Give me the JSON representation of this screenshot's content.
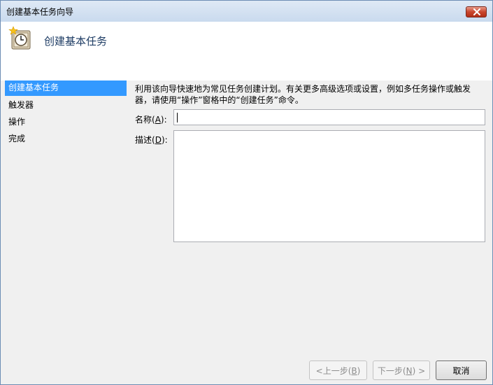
{
  "window": {
    "title": "创建基本任务向导"
  },
  "header": {
    "title": "创建基本任务"
  },
  "nav": {
    "items": [
      {
        "label": "创建基本任务",
        "active": true
      },
      {
        "label": "触发器",
        "active": false
      },
      {
        "label": "操作",
        "active": false
      },
      {
        "label": "完成",
        "active": false
      }
    ]
  },
  "main": {
    "description": "利用该向导快速地为常见任务创建计划。有关更多高级选项或设置，例如多任务操作或触发器，请使用“操作”窗格中的“创建任务”命令。",
    "name_label": "名称",
    "name_key": "A",
    "name_value": "",
    "desc_label": "描述",
    "desc_key": "D",
    "desc_value": ""
  },
  "buttons": {
    "back_label": "<上一步",
    "back_key": "B",
    "next_label": "下一步",
    "next_key": "N",
    "next_suffix": " >",
    "cancel_label": "取消"
  },
  "colors": {
    "selection": "#3399ff",
    "header_title": "#1e3c64",
    "close_button": "#c9462d"
  }
}
